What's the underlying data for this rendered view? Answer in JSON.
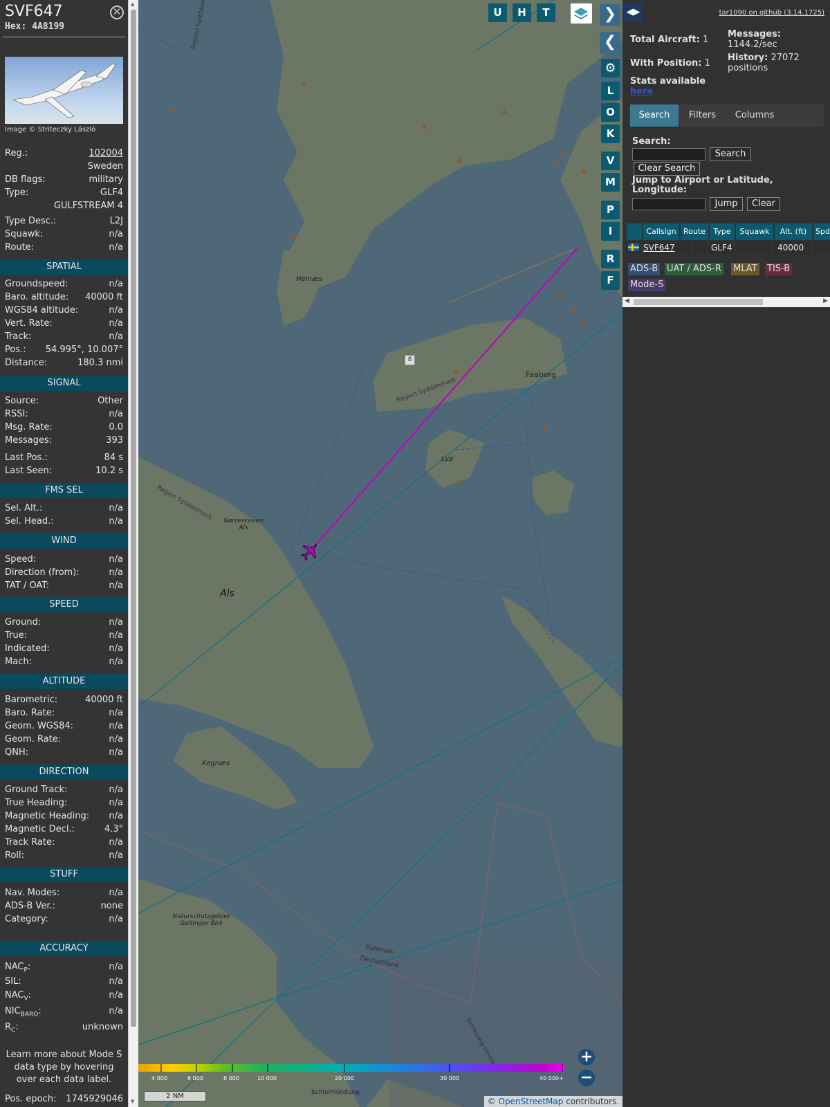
{
  "aircraft": {
    "callsign": "SVF647",
    "hex_label": "Hex:",
    "hex": "4A8199",
    "close_icon": "close-icon",
    "image_credit": "Image © Striteczky László"
  },
  "details": {
    "reg_label": "Reg.:",
    "reg": "102004",
    "country": "Sweden",
    "dbflags_label": "DB flags:",
    "dbflags": "military",
    "type_label": "Type:",
    "type": "GLF4",
    "type_name": "GULFSTREAM 4",
    "typedesc_label": "Type Desc.:",
    "typedesc": "L2J",
    "squawk_label": "Squawk:",
    "squawk": "n/a",
    "route_label": "Route:",
    "route": "n/a"
  },
  "sections": {
    "spatial": "SPATIAL",
    "signal": "SIGNAL",
    "fms": "FMS SEL",
    "wind": "WIND",
    "speed": "SPEED",
    "altitude": "ALTITUDE",
    "direction": "DIRECTION",
    "stuff": "STUFF",
    "accuracy": "ACCURACY"
  },
  "spatial": {
    "groundspeed_l": "Groundspeed:",
    "groundspeed": "n/a",
    "baro_l": "Baro. altitude:",
    "baro": "40000 ft",
    "wgs_l": "WGS84 altitude:",
    "wgs": "n/a",
    "vert_l": "Vert. Rate:",
    "vert": "n/a",
    "track_l": "Track:",
    "track": "n/a",
    "pos_l": "Pos.:",
    "pos": "54.995°, 10.007°",
    "dist_l": "Distance:",
    "dist": "180.3 nmi"
  },
  "signal": {
    "source_l": "Source:",
    "source": "Other",
    "rssi_l": "RSSI:",
    "rssi": "n/a",
    "msgrate_l": "Msg. Rate:",
    "msgrate": "0.0",
    "messages_l": "Messages:",
    "messages": "393",
    "lastpos_l": "Last Pos.:",
    "lastpos": "84 s",
    "lastseen_l": "Last Seen:",
    "lastseen": "10.2 s"
  },
  "fms": {
    "selalt_l": "Sel. Alt.:",
    "selalt": "n/a",
    "selhead_l": "Sel. Head.:",
    "selhead": "n/a"
  },
  "wind": {
    "speed_l": "Speed:",
    "speed": "n/a",
    "dir_l": "Direction (from):",
    "dir": "n/a",
    "tat_l": "TAT / OAT:",
    "tat": "n/a"
  },
  "speed": {
    "ground_l": "Ground:",
    "ground": "n/a",
    "true_l": "True:",
    "true": "n/a",
    "ind_l": "Indicated:",
    "ind": "n/a",
    "mach_l": "Mach:",
    "mach": "n/a"
  },
  "altitude": {
    "baro_l": "Barometric:",
    "baro": "40000 ft",
    "rate_l": "Baro. Rate:",
    "rate": "n/a",
    "geom_l": "Geom. WGS84:",
    "geom": "n/a",
    "grate_l": "Geom. Rate:",
    "grate": "n/a",
    "qnh_l": "QNH:",
    "qnh": "n/a"
  },
  "direction": {
    "gt_l": "Ground Track:",
    "gt": "n/a",
    "th_l": "True Heading:",
    "th": "n/a",
    "mh_l": "Magnetic Heading:",
    "mh": "n/a",
    "md_l": "Magnetic Decl.:",
    "md": "4.3°",
    "tr_l": "Track Rate:",
    "tr": "n/a",
    "roll_l": "Roll:",
    "roll": "n/a"
  },
  "stuff": {
    "nav_l": "Nav. Modes:",
    "nav": "n/a",
    "adsb_l": "ADS-B Ver.:",
    "adsb": "none",
    "cat_l": "Category:",
    "cat": "n/a"
  },
  "accuracy": {
    "nacp_l": "NAC",
    "nacp_sub": "P",
    "nacp": "n/a",
    "sil_l": "SIL:",
    "sil": "n/a",
    "nacv_l": "NAC",
    "nacv_sub": "V",
    "nacv": "n/a",
    "nic_l": "NIC",
    "nic_sub": "BARO",
    "nic": "n/a",
    "rc_l": "R",
    "rc_sub": "C",
    "rc": "unknown"
  },
  "learn_more": "Learn more about Mode S data type by hovering over each data label.",
  "epoch_l": "Pos. epoch:",
  "epoch": "1745929046",
  "map": {
    "buttons_top": [
      "U",
      "H",
      "T"
    ],
    "buttons_side": [
      "L",
      "O",
      "K",
      "V",
      "M",
      "P",
      "I",
      "R",
      "F"
    ],
    "places": [
      "Region Syddanmark",
      "Helnæs",
      "Faaborg",
      "Lyø",
      "Region Syddanmark",
      "Region Syddanmark",
      "Nørreskoven Als",
      "Als",
      "Kegnæs",
      "Naturschutzgebiet Geltinger Birk",
      "Danmark",
      "Deutschland",
      "Schleswig-Holstein",
      "Schleimündung",
      "8"
    ],
    "colorbar_ticks": [
      "4 000",
      "6 000",
      "8 000",
      "10 000",
      "20 000",
      "30 000",
      "40 000+"
    ],
    "scale": "2 NM",
    "attribution_pre": "© ",
    "attribution_link": "OpenStreetMap",
    "attribution_post": " contributors."
  },
  "panel": {
    "github": "tar1090 on github (3.14.1725)",
    "total_l": "Total Aircraft:",
    "total": "1",
    "withpos_l": "With Position:",
    "withpos": "1",
    "messages_l": "Messages:",
    "messages": "1144.2/sec",
    "history_l": "History:",
    "history": "27072 positions",
    "stats": "Stats available",
    "stats_link": "here",
    "tabs": [
      "Search",
      "Filters",
      "Columns"
    ],
    "search_l": "Search:",
    "search_btn": "Search",
    "clear_search": "Clear Search",
    "jump_l": "Jump to Airport or Latitude, Longitude:",
    "jump_btn": "Jump",
    "clear_btn": "Clear",
    "columns": [
      "Callsign",
      "Route",
      "Type",
      "Squawk",
      "Alt. (ft)",
      "Spd."
    ],
    "row": {
      "callsign": "SVF647",
      "route": "",
      "type": "GLF4",
      "squawk": "",
      "alt": "40000"
    },
    "legend": [
      "ADS-B",
      "UAT / ADS-R",
      "MLAT",
      "TIS-B",
      "Mode-S"
    ]
  },
  "colors": {
    "accent": "#0b5a6f",
    "track": "#c000c0",
    "sea": "#4f6877",
    "land": "#6e7866"
  }
}
